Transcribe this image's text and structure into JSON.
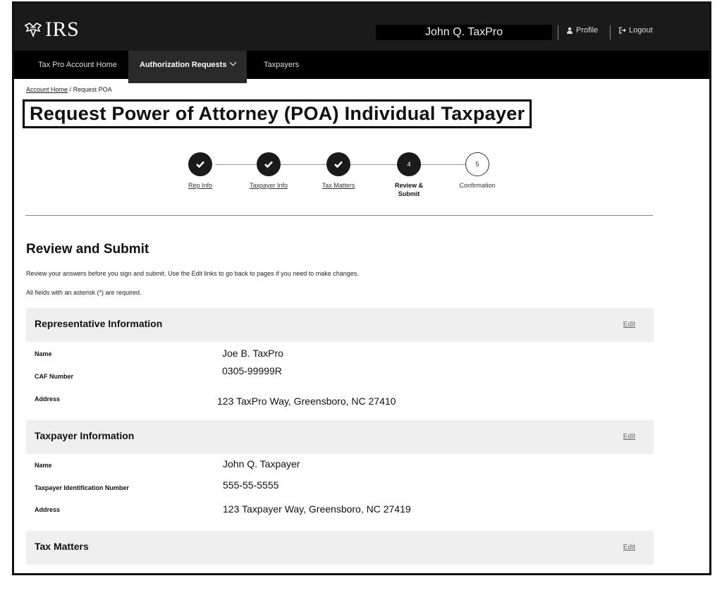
{
  "header": {
    "logo_text": "IRS",
    "user_name": "John Q. TaxPro",
    "profile_label": "Profile",
    "logout_label": "Logout"
  },
  "nav": {
    "items": [
      "Tax Pro Account Home",
      "Authorization Requests",
      "Taxpayers"
    ]
  },
  "breadcrumb": {
    "home": "Account Home",
    "separator": "/",
    "current": "Request POA"
  },
  "page_title": "Request Power of Attorney (POA) Individual Taxpayer",
  "stepper": {
    "steps": [
      {
        "label": "Rep Info",
        "state": "complete"
      },
      {
        "label": "Taxpayer Info",
        "state": "complete"
      },
      {
        "label": "Tax Matters",
        "state": "complete"
      },
      {
        "label": "Review & Submit",
        "number": "4",
        "state": "current"
      },
      {
        "label": "Confirmation",
        "number": "5",
        "state": "upcoming"
      }
    ]
  },
  "review": {
    "title": "Review and Submit",
    "intro": "Review your answers before you sign and submit. Use the Edit links to go back to pages if you need to make changes.",
    "required_note": "All fields with an asterisk (*) are required.",
    "edit_label": "Edit",
    "representative": {
      "heading": "Representative Information",
      "name_label": "Name",
      "name": "Joe B. TaxPro",
      "caf_label": "CAF Number",
      "caf": "0305-99999R",
      "address_label": "Address",
      "address": "123 TaxPro Way, Greensboro, NC 27410"
    },
    "taxpayer": {
      "heading": "Taxpayer Information",
      "name_label": "Name",
      "name": "John Q. Taxpayer",
      "tin_label": "Taxpayer Identification Number",
      "tin": "555-55-5555",
      "address_label": "Address",
      "address": "123 Taxpayer Way, Greensboro, NC 27419"
    },
    "tax_matters": {
      "heading": "Tax Matters"
    }
  },
  "colors": {
    "header_bg": "#1a1a1a",
    "nav_bg": "#000000",
    "panel_bg": "#efefef",
    "step_complete": "#1a1a1a"
  }
}
